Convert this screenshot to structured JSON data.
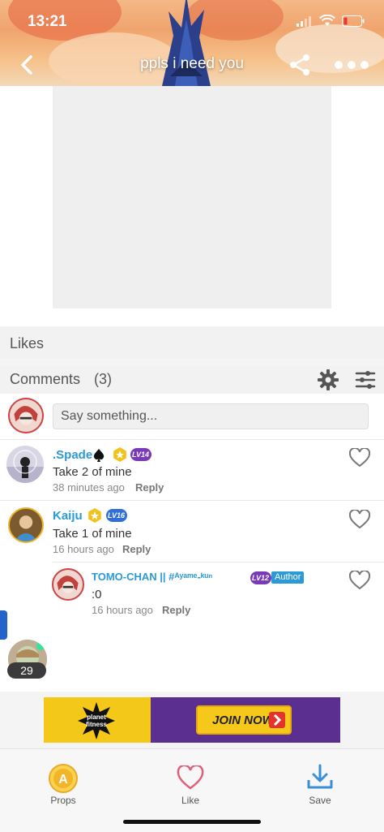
{
  "status_bar": {
    "time": "13:21"
  },
  "nav": {
    "title": "ppls i need you"
  },
  "likes": {
    "label": "Likes"
  },
  "comments": {
    "label": "Comments",
    "count": "(3)",
    "input_placeholder": "Say something...",
    "items": [
      {
        "name": ".Spade",
        "level": "LV14",
        "text": "Take 2 of mine",
        "time": "38 minutes ago",
        "reply": "Reply"
      },
      {
        "name": "Kaiju",
        "level": "LV16",
        "text": "Take 1 of mine",
        "time": "16 hours ago",
        "reply": "Reply"
      },
      {
        "name": "TOMO-CHAN || #ᴬʸᵃᵐᵉ-ᵏᵘⁿ",
        "level": "LV12",
        "author_tag": "Author",
        "text": ":0",
        "time": "16 hours ago",
        "reply": "Reply"
      }
    ]
  },
  "online": {
    "count": "29"
  },
  "ad": {
    "logo_text": "planet fitness",
    "button": "JOIN NOW"
  },
  "bottom_tabs": [
    {
      "label": "Props",
      "icon": "props-coin-icon"
    },
    {
      "label": "Like",
      "icon": "heart-icon"
    },
    {
      "label": "Save",
      "icon": "download-icon"
    }
  ],
  "colors": {
    "accent": "#2b9ad6",
    "like": "#e0607a",
    "save": "#3a8fd8",
    "props": "#f2c12e"
  }
}
